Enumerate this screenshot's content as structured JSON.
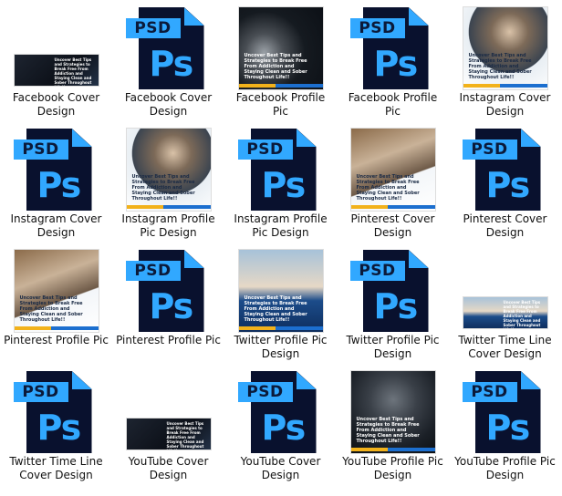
{
  "items": [
    {
      "label": "Facebook Cover Design",
      "kind": "image",
      "style": "wide dark-bg",
      "thumb_text": "Uncover Best Tips and Strategies to Break Free From Addiction and Staying Clean and Sober Throughout Life!!"
    },
    {
      "label": "Facebook Cover Design",
      "kind": "psd"
    },
    {
      "label": "Facebook Profile Pic",
      "kind": "image",
      "style": "sq smoke",
      "thumb_text": "Uncover Best Tips and Strategies to Break Free From Addiction and Staying Clean and Sober Throughout Life!!"
    },
    {
      "label": "Facebook Profile Pic",
      "kind": "psd"
    },
    {
      "label": "Instagram Cover Design",
      "kind": "image",
      "style": "tall man",
      "thumb_text": "Uncover Best Tips and Strategies to Break Free From Addiction and Staying Clean and Sober Throughout Life!!"
    },
    {
      "label": "Instagram Cover Design",
      "kind": "psd"
    },
    {
      "label": "Instagram Profile Pic Design",
      "kind": "image",
      "style": "sq man",
      "thumb_text": "Uncover Best Tips and Strategies to Break Free From Addiction and Staying Clean and Sober Throughout Life!!"
    },
    {
      "label": "Instagram Profile Pic Design",
      "kind": "psd"
    },
    {
      "label": "Pinterest Cover Design",
      "kind": "image",
      "style": "tall wood",
      "thumb_text": "Uncover Best Tips and Strategies to Break Free From Addiction and Staying Clean and Sober Throughout Life!!"
    },
    {
      "label": "Pinterest Cover Design",
      "kind": "psd"
    },
    {
      "label": "Pinterest Profile Pic",
      "kind": "image",
      "style": "sq wood",
      "thumb_text": "Uncover Best Tips and Strategies to Break Free From Addiction and Staying Clean and Sober Throughout Life!!"
    },
    {
      "label": "Pinterest Profile Pic",
      "kind": "psd"
    },
    {
      "label": "Twitter Profile Pic Design",
      "kind": "image",
      "style": "sq hand",
      "thumb_text": "Uncover Best Tips and Strategies to Break Free From Addiction and Staying Clean and Sober Throughout Life!!"
    },
    {
      "label": "Twitter Profile Pic Design",
      "kind": "psd"
    },
    {
      "label": "Twitter Time Line Cover Design",
      "kind": "image",
      "style": "wide hand",
      "thumb_text": "Uncover Best Tips and Strategies to Break Free From Addiction and Staying Clean and Sober Throughout Life!!"
    },
    {
      "label": "Twitter Time Line Cover Design",
      "kind": "psd"
    },
    {
      "label": "YouTube Cover Design",
      "kind": "image",
      "style": "wide dark-bg",
      "thumb_text": "Uncover Best Tips and Strategies to Break Free From Addiction and Staying Clean and Sober Throughout Life!!"
    },
    {
      "label": "YouTube Cover Design",
      "kind": "psd"
    },
    {
      "label": "YouTube Profile Pic Design",
      "kind": "image",
      "style": "tall hood",
      "thumb_text": "Uncover Best Tips and Strategies to Break Free From Addiction and Staying Clean and Sober Throughout Life!!"
    },
    {
      "label": "YouTube Profile Pic Design",
      "kind": "psd"
    }
  ],
  "psd_icon": {
    "banner": "PSD",
    "glyph": "Ps",
    "page_color": "#09112e",
    "accent_color": "#31a8ff"
  }
}
